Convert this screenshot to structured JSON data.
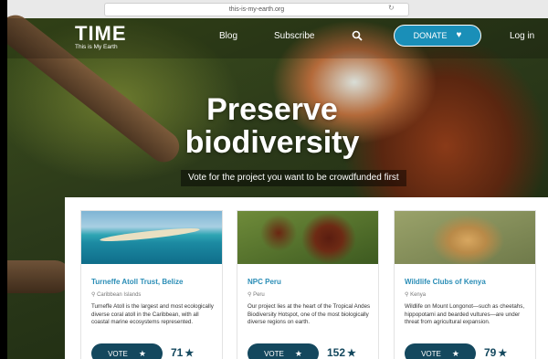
{
  "browser": {
    "url": "this-is-my-earth.org"
  },
  "header": {
    "logo_main": "TIME",
    "logo_sub": "This is My Earth",
    "nav": {
      "blog": "Blog",
      "subscribe": "Subscribe",
      "login": "Log in"
    },
    "donate_label": "DONATE",
    "icons": {
      "search": "search-icon",
      "heart": "heart-icon"
    }
  },
  "hero": {
    "title": "Preserve biodiversity",
    "subtitle": "Vote for the project you want to be crowdfunded first"
  },
  "cards": [
    {
      "title": "Turneffe Atoll Trust, Belize",
      "location": "Caribbean Islands",
      "description": "Turneffe Atoll is the largest and most ecologically diverse coral atoll in the Caribbean, with all coastal marine ecosystems represented.",
      "vote_label": "VOTE",
      "votes": "71"
    },
    {
      "title": "NPC Peru",
      "location": "Peru",
      "description": "Our project lies at the heart of the Tropical Andes Biodiversity Hotspot, one of the most biologically diverse regions on earth.",
      "vote_label": "VOTE",
      "votes": "152"
    },
    {
      "title": "Wildlife Clubs of Kenya",
      "location": "Kenya",
      "description": "Wildlife on Mount Longonot—such as cheetahs, hippopotami and bearded vultures—are under threat from agricultural expansion.",
      "vote_label": "VOTE",
      "votes": "79"
    }
  ],
  "colors": {
    "accent": "#2a8db6",
    "donate_bg": "#1a8fb8",
    "vote_bg": "#14485e"
  }
}
